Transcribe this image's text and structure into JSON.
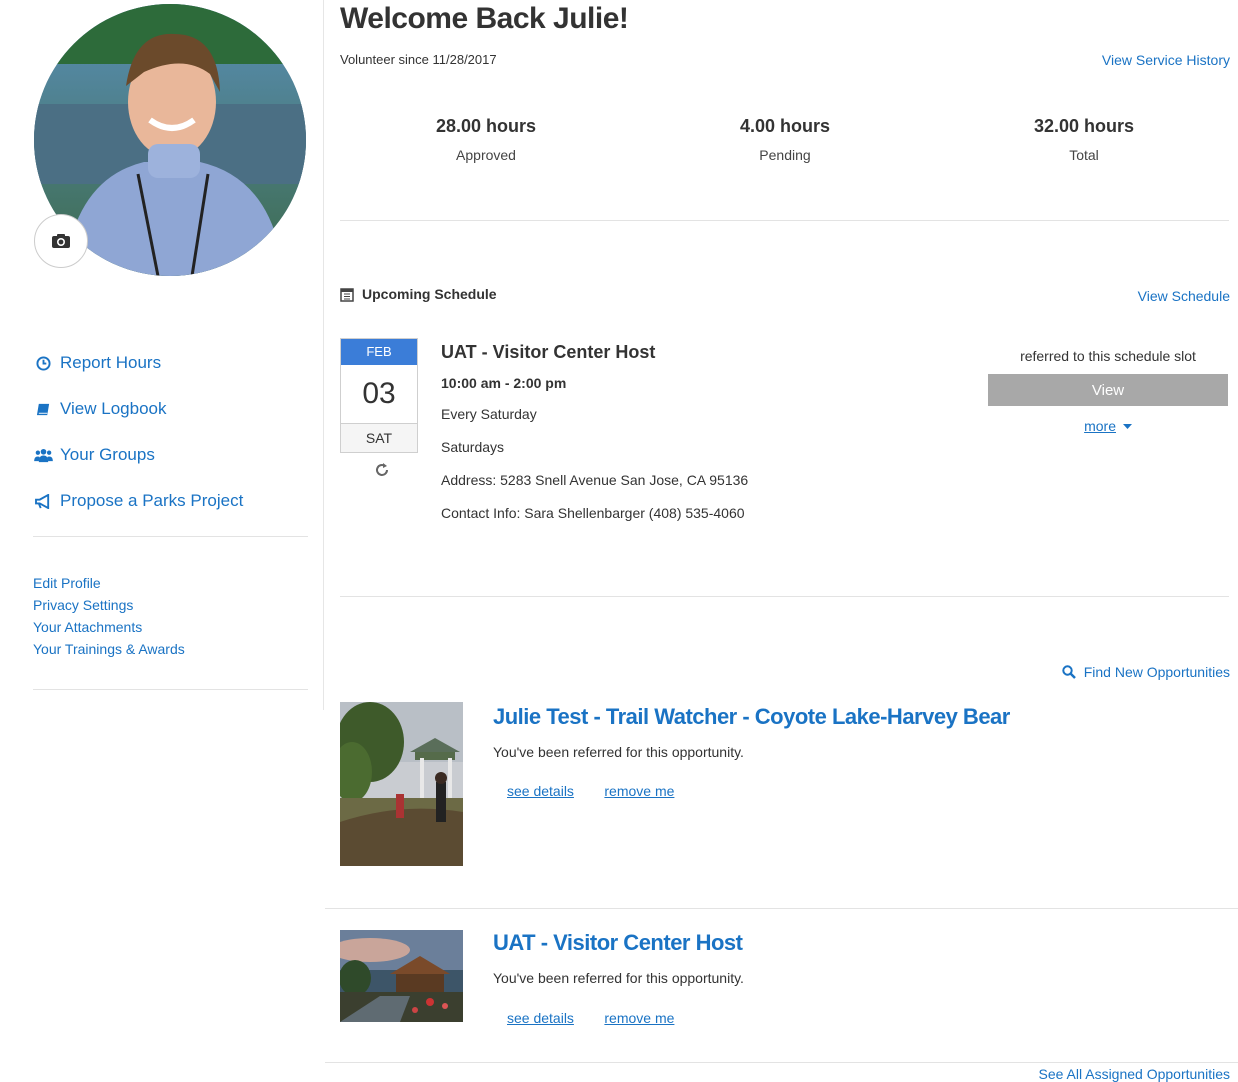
{
  "header": {
    "welcome": "Welcome Back Julie!",
    "volunteer_since": "Volunteer since 11/28/2017",
    "view_service_history": "View Service History"
  },
  "stats": [
    {
      "value": "28.00 hours",
      "label": "Approved"
    },
    {
      "value": "4.00 hours",
      "label": "Pending"
    },
    {
      "value": "32.00 hours",
      "label": "Total"
    }
  ],
  "sidebar": {
    "nav": [
      {
        "label": "Report Hours",
        "icon": "clock-icon"
      },
      {
        "label": "View Logbook",
        "icon": "book-icon"
      },
      {
        "label": "Your Groups",
        "icon": "users-icon"
      },
      {
        "label": "Propose a Parks Project",
        "icon": "bullhorn-icon"
      }
    ],
    "links": [
      "Edit Profile",
      "Privacy Settings",
      "Your Attachments",
      "Your Trainings & Awards"
    ]
  },
  "schedule": {
    "title": "Upcoming Schedule",
    "view_link": "View Schedule",
    "event": {
      "month": "FEB",
      "day": "03",
      "weekday": "SAT",
      "title": "UAT - Visitor Center Host",
      "time": "10:00 am - 2:00 pm",
      "recurrence": "Every Saturday",
      "note": "Saturdays",
      "address": "Address: 5283 Snell Avenue San Jose, CA 95136",
      "contact": "Contact Info: Sara Shellenbarger (408) 535-4060",
      "referred": "referred to this schedule slot",
      "view_button": "View",
      "more": "more"
    }
  },
  "opportunities": {
    "find_new": "Find New Opportunities",
    "see_all": "See All Assigned Opportunities",
    "items": [
      {
        "title": "Julie Test - Trail Watcher - Coyote Lake-Harvey Bear",
        "subtitle": "You've been referred for this opportunity.",
        "details": "see details",
        "remove": "remove me"
      },
      {
        "title": "UAT - Visitor Center Host",
        "subtitle": "You've been referred for this opportunity.",
        "details": "see details",
        "remove": "remove me"
      }
    ]
  },
  "colors": {
    "link": "#1a73c4",
    "calendar_header": "#3b7dd8",
    "button_disabled": "#a8a8a8"
  }
}
